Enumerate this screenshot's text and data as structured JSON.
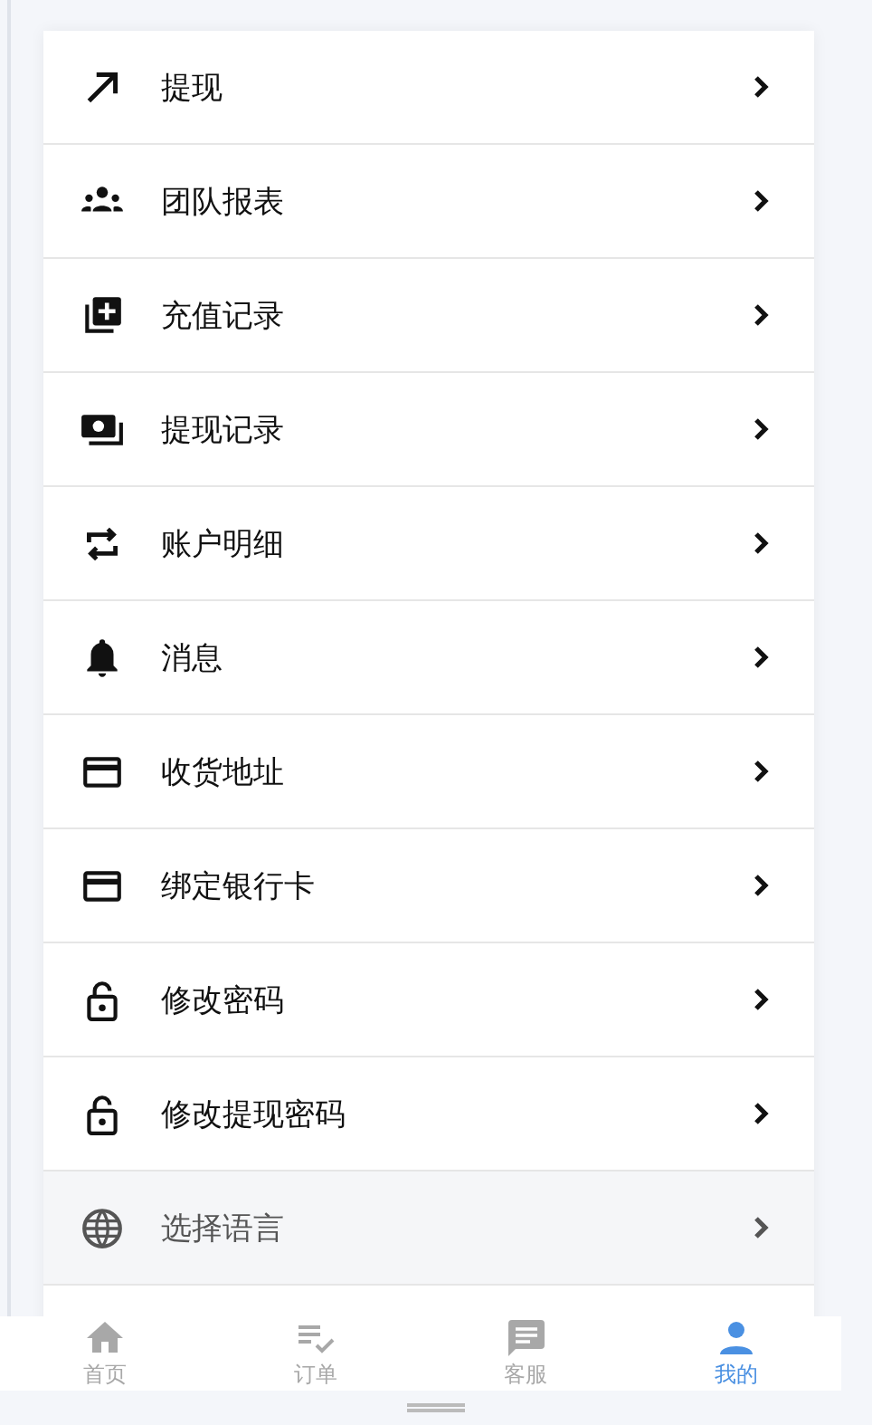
{
  "menu": [
    {
      "kind": "arrow",
      "label": "提现",
      "highlighted": false
    },
    {
      "kind": "team",
      "label": "团队报表",
      "highlighted": false
    },
    {
      "kind": "add",
      "label": "充值记录",
      "highlighted": false
    },
    {
      "kind": "money",
      "label": "提现记录",
      "highlighted": false
    },
    {
      "kind": "repeat",
      "label": "账户明细",
      "highlighted": false
    },
    {
      "kind": "bell",
      "label": "消息",
      "highlighted": false
    },
    {
      "kind": "card",
      "label": "收货地址",
      "highlighted": false
    },
    {
      "kind": "card",
      "label": "绑定银行卡",
      "highlighted": false
    },
    {
      "kind": "lock",
      "label": "修改密码",
      "highlighted": false
    },
    {
      "kind": "lock",
      "label": "修改提现密码",
      "highlighted": false
    },
    {
      "kind": "globe",
      "label": "选择语言",
      "highlighted": true
    }
  ],
  "tabbar": [
    {
      "kind": "home",
      "label": "首页",
      "selected": false
    },
    {
      "kind": "orders",
      "label": "订单",
      "selected": false
    },
    {
      "kind": "chat",
      "label": "客服",
      "selected": false
    },
    {
      "kind": "user",
      "label": "我的",
      "selected": true
    }
  ]
}
